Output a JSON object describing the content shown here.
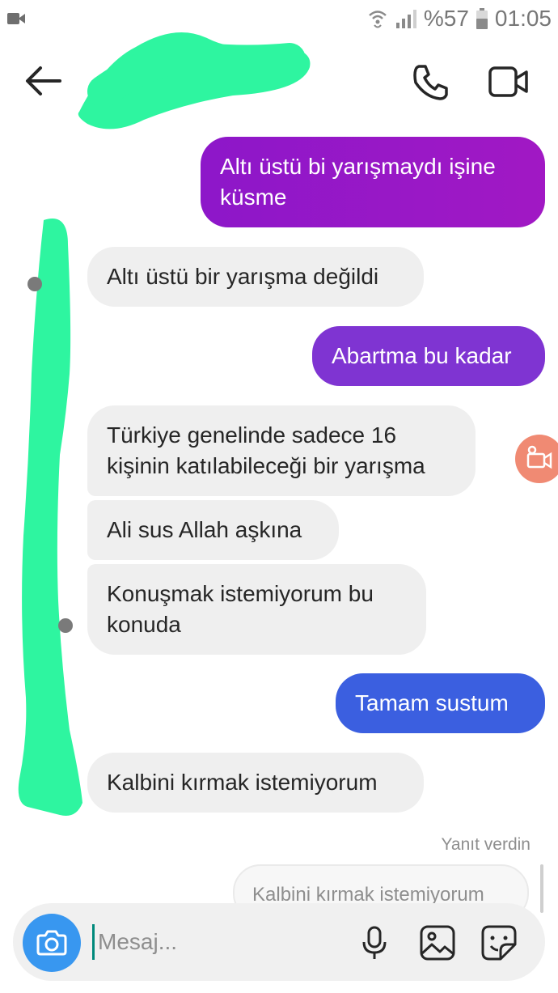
{
  "status_bar": {
    "left_icon": "video-camera-icon",
    "icons": [
      "wifi-calling-icon",
      "signal-icon"
    ],
    "battery": "%57",
    "time": "01:05"
  },
  "header": {
    "back_icon": "arrow-left-icon",
    "call_icon": "phone-icon",
    "video_icon": "video-camera-icon"
  },
  "messages": [
    {
      "side": "out",
      "text": "Altı üstü bi yarışmaydı işine\nküsme"
    },
    {
      "side": "in",
      "text": "Altı üstü bir yarışma değildi"
    },
    {
      "side": "out",
      "text": "Abartma bu kadar"
    },
    {
      "side": "in",
      "text": "Türkiye genelinde sadece 16\nkişinin katılabileceği bir yarışma"
    },
    {
      "side": "in",
      "text": "Ali sus Allah aşkına"
    },
    {
      "side": "in",
      "text": "Konuşmak istemiyorum bu\nkonuda"
    },
    {
      "side": "out",
      "text": "Tamam sustum"
    },
    {
      "side": "in",
      "text": "Kalbini kırmak istemiyorum"
    }
  ],
  "reply": {
    "label": "Yanıt verdin",
    "quoted_text": "Kalbini kırmak istemiyorum"
  },
  "composer": {
    "placeholder": "Mesaj...",
    "value": "",
    "camera_icon": "camera-icon",
    "mic_icon": "microphone-icon",
    "gallery_icon": "image-icon",
    "sticker_icon": "sticker-icon"
  },
  "colors": {
    "outgoing_top": "#9417c9",
    "outgoing_mid": "#7f34d2",
    "outgoing_bottom": "#3b5fe0",
    "incoming": "#efefef",
    "camera_button": "#3897f0",
    "redaction": "#2ef5a0"
  }
}
